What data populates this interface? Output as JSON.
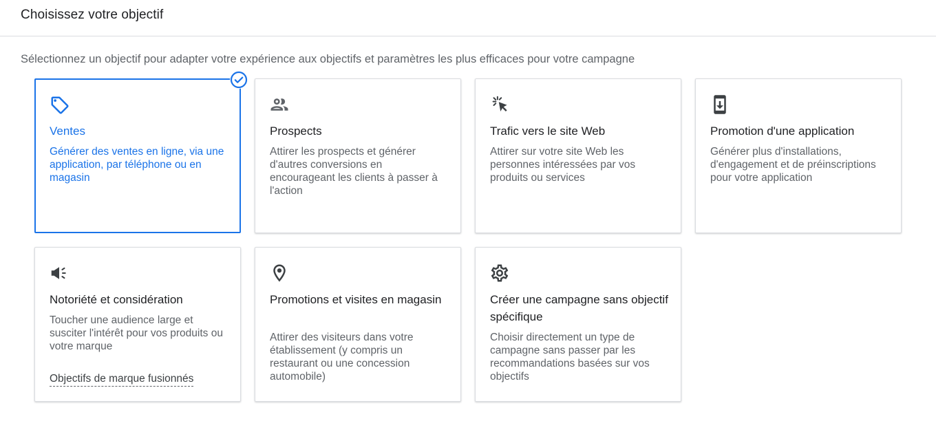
{
  "header": {
    "title": "Choisissez votre objectif"
  },
  "subtitle": "Sélectionnez un objectif pour adapter votre expérience aux objectifs et paramètres les plus efficaces pour votre campagne",
  "colors": {
    "accent": "#1a73e8",
    "text_primary": "#202124",
    "text_secondary": "#5f6368",
    "border": "#dadce0"
  },
  "goals": [
    {
      "icon": "tag-icon",
      "title": "Ventes",
      "description": "Générer des ventes en ligne, via une application, par téléphone ou en magasin",
      "selected": true
    },
    {
      "icon": "people-icon",
      "title": "Prospects",
      "description": "Attirer les prospects et générer d'autres conversions en encourageant les clients à passer à l'action",
      "selected": false
    },
    {
      "icon": "cursor-click-icon",
      "title": "Trafic vers le site Web",
      "description": "Attirer sur votre site Web les personnes intéressées par vos produits ou services",
      "selected": false
    },
    {
      "icon": "phone-download-icon",
      "title": "Promotion d'une application",
      "description": "Générer plus d'installations, d'engagement et de préinscriptions pour votre application",
      "selected": false
    },
    {
      "icon": "megaphone-icon",
      "title": "Notoriété et considération",
      "description": "Toucher une audience large et susciter l'intérêt pour vos produits ou votre marque",
      "link": "Objectifs de marque fusionnés",
      "selected": false
    },
    {
      "icon": "location-pin-icon",
      "title": "Promotions et visites en magasin",
      "description": "Attirer des visiteurs dans votre établissement (y compris un restaurant ou une concession automobile)",
      "selected": false
    },
    {
      "icon": "gear-icon",
      "title": "Créer une campagne sans objectif spécifique",
      "description": "Choisir directement un type de campagne sans passer par les recommandations basées sur vos objectifs",
      "selected": false
    }
  ]
}
